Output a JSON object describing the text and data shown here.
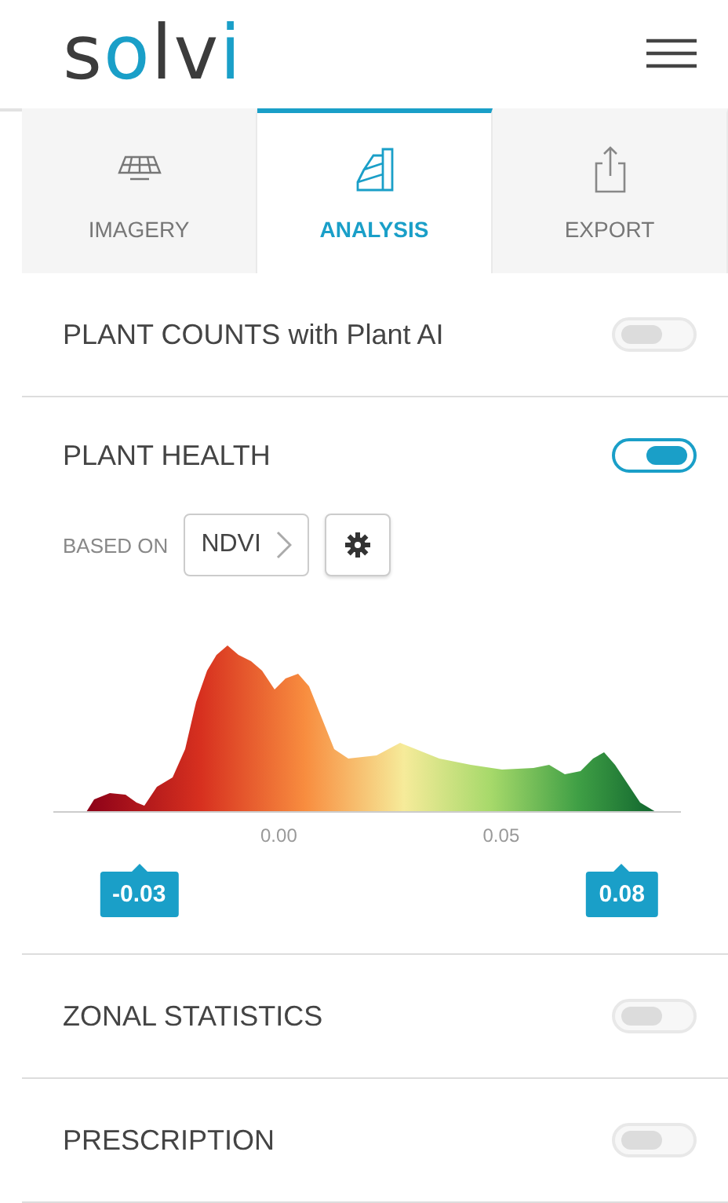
{
  "header": {
    "logo": "solvi"
  },
  "tabs": [
    {
      "label": "IMAGERY",
      "selected": false
    },
    {
      "label": "ANALYSIS",
      "selected": true
    },
    {
      "label": "EXPORT",
      "selected": false
    }
  ],
  "sections": [
    {
      "title": "PLANT COUNTS with Plant AI",
      "on": false
    },
    {
      "title": "PLANT HEALTH",
      "on": true,
      "based_on_label": "BASED ON",
      "index_button": "NDVI",
      "histogram": {
        "ticks": [
          "0.00",
          "0.05"
        ],
        "low": "-0.03",
        "high": "0.08"
      }
    },
    {
      "title": "ZONAL STATISTICS",
      "on": false
    },
    {
      "title": "PRESCRIPTION",
      "on": false
    }
  ]
}
